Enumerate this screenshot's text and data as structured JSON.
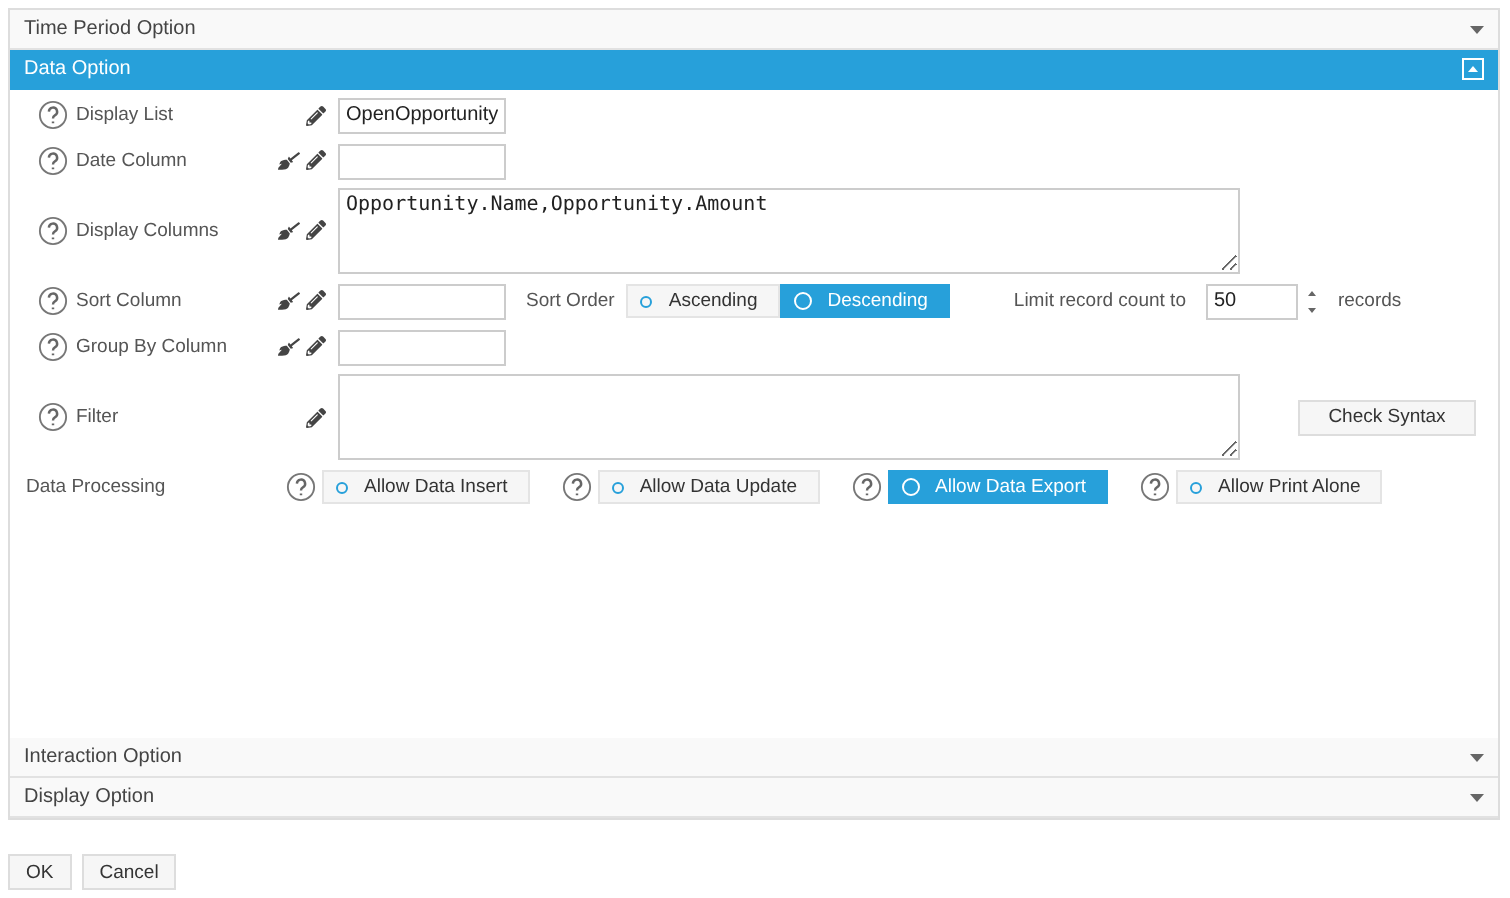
{
  "sections_before": [
    {
      "title": "Time Period Option",
      "expanded": false
    }
  ],
  "data_section": {
    "title": "Data Option",
    "expanded": true,
    "fields": [
      {
        "kind": "input",
        "label": "Display List",
        "picker": false,
        "value": "OpenOpportunity"
      },
      {
        "kind": "input",
        "label": "Date Column",
        "picker": true
      },
      {
        "kind": "textarea",
        "label": "Display Columns",
        "picker": true,
        "value": "Opportunity.Name,Opportunity.Amount"
      },
      {
        "kind": "input",
        "label": "Sort Column",
        "picker": true,
        "sort_order": {
          "label": "Sort Order",
          "options": [
            {
              "label": "Ascending",
              "selected": false
            },
            {
              "label": "Descending",
              "selected": true
            }
          ]
        },
        "limit": {
          "label": "Limit record count to",
          "value": "50",
          "unit": "records"
        }
      },
      {
        "kind": "input",
        "label": "Group By Column",
        "picker": true
      },
      {
        "kind": "textarea",
        "label": "Filter",
        "picker": false,
        "button": "Check Syntax"
      }
    ],
    "processing": {
      "label": "Data Processing",
      "options": [
        {
          "label": "Allow Data Insert",
          "checked": false
        },
        {
          "label": "Allow Data Update",
          "checked": false
        },
        {
          "label": "Allow Data Export",
          "checked": true
        },
        {
          "label": "Allow Print Alone",
          "checked": false
        }
      ]
    }
  },
  "sections_after": [
    {
      "title": "Interaction Option",
      "expanded": false
    },
    {
      "title": "Display Option",
      "expanded": false
    }
  ],
  "buttons": [
    "OK",
    "Cancel"
  ]
}
